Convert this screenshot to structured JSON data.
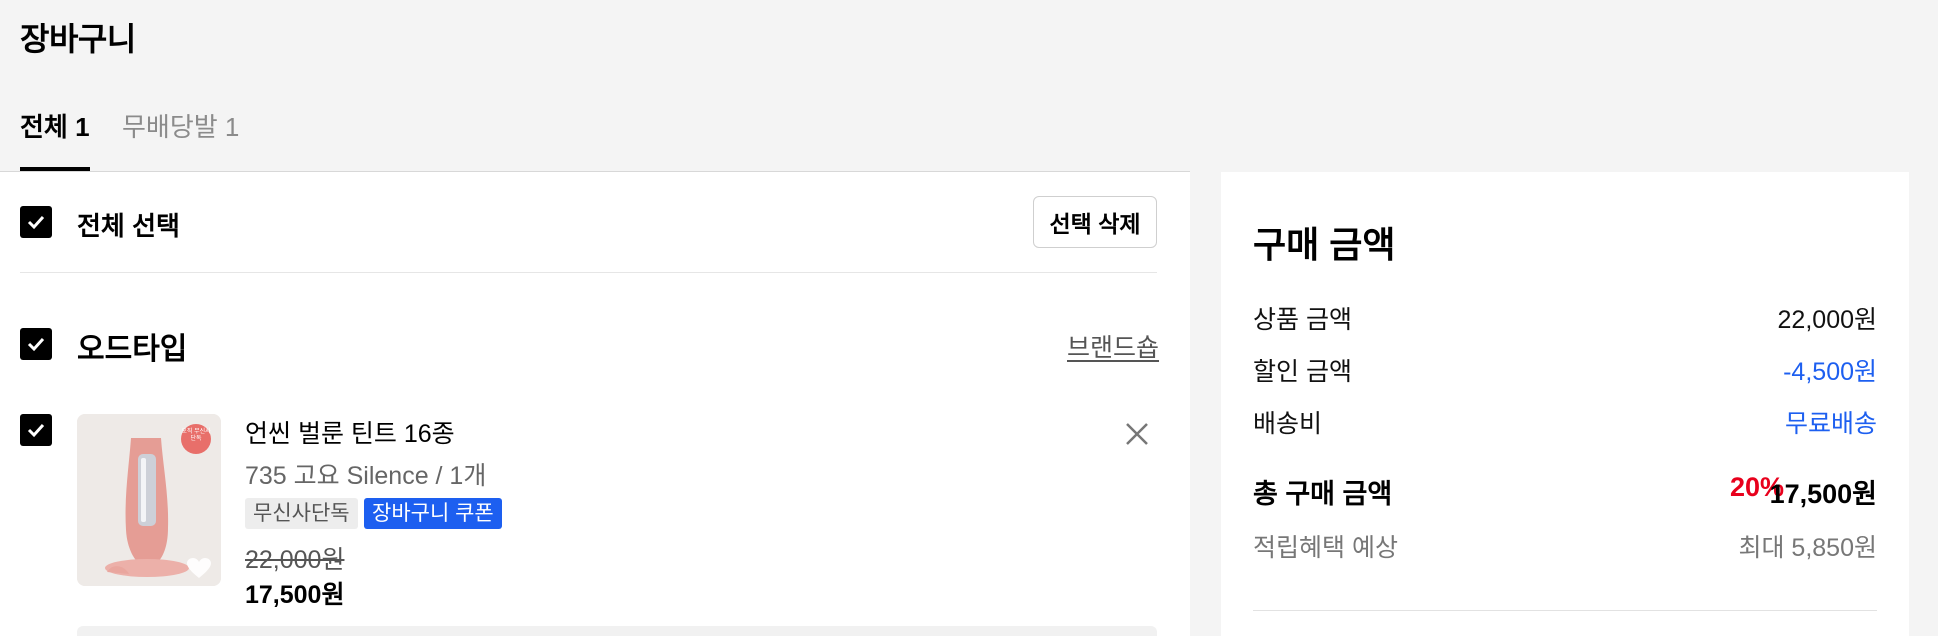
{
  "page": {
    "title": "장바구니"
  },
  "tabs": [
    {
      "label": "전체 1"
    },
    {
      "label": "무배당발 1"
    }
  ],
  "cart": {
    "select_all_label": "전체 선택",
    "delete_selected_label": "선택 삭제",
    "brand": {
      "name": "오드타입",
      "shop_link_label": "브랜드숍"
    },
    "item": {
      "name": "언씬 벌룬 틴트 16종",
      "option": "735 고요 Silence / 1개",
      "badges": [
        "무신사단독",
        "장바구니 쿠폰"
      ],
      "thumbnail_badge": "오직 무신사 단독",
      "original_price": "22,000원",
      "sale_price": "17,500원"
    }
  },
  "summary": {
    "title": "구매 금액",
    "rows": [
      {
        "label": "상품 금액",
        "value": "22,000원"
      },
      {
        "label": "할인 금액",
        "value": "-4,500원"
      },
      {
        "label": "배송비",
        "value": "무료배송"
      }
    ],
    "total": {
      "label": "총 구매 금액",
      "discount_rate": "20%",
      "value": "17,500원"
    },
    "reward": {
      "label": "적립혜택 예상",
      "value": "최대 5,850원"
    }
  },
  "icons": {
    "checkbox": "check-icon",
    "remove": "close-icon",
    "wishlist": "heart-icon"
  },
  "colors": {
    "accent_blue": "#1d5ff0",
    "discount_red": "#e8001c",
    "background": "#f4f4f4"
  }
}
